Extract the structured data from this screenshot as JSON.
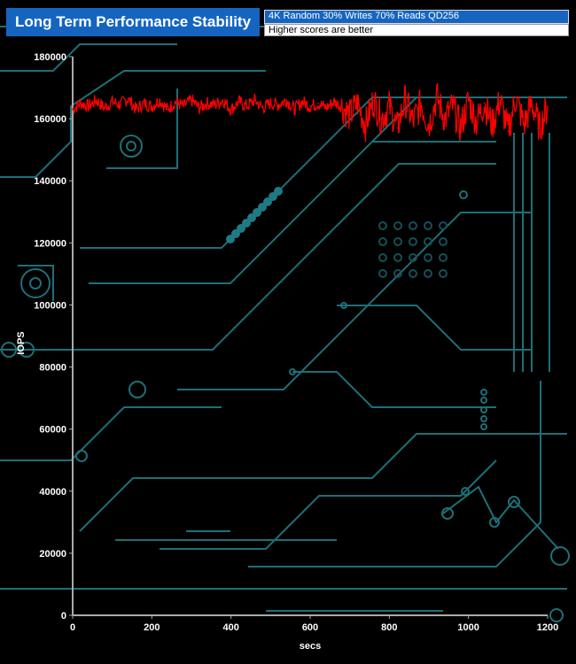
{
  "header": {
    "title": "Long Term Performance Stability",
    "subtitle": "4K Random 30% Writes 70% Reads QD256",
    "note": "Higher scores are better"
  },
  "chart_data": {
    "type": "line",
    "xlabel": "secs",
    "ylabel": "IOPS",
    "xlim": [
      0,
      1200
    ],
    "ylim": [
      0,
      180000
    ],
    "x_ticks": [
      0,
      200,
      400,
      600,
      800,
      1000,
      1200
    ],
    "y_ticks": [
      0,
      20000,
      40000,
      60000,
      80000,
      100000,
      120000,
      140000,
      160000,
      180000
    ],
    "x_tick_labels": [
      "0",
      "200",
      "400",
      "600",
      "800",
      "1000",
      "1200"
    ],
    "y_tick_labels": [
      "0",
      "20000",
      "40000",
      "60000",
      "80000",
      "100000",
      "120000",
      "140000",
      "160000",
      "180000"
    ],
    "grid": false,
    "line_color": "#ff0000",
    "series": [
      {
        "x": [
          0,
          20,
          40,
          60,
          80,
          100,
          120,
          140,
          160,
          180,
          200,
          220,
          240,
          260,
          280,
          300,
          320,
          340,
          360,
          380,
          400,
          420,
          440,
          460,
          480,
          500,
          520,
          540,
          560,
          580,
          600,
          620,
          640,
          660,
          680,
          700,
          720,
          740,
          760,
          780,
          800,
          820,
          840,
          860,
          880,
          900,
          920,
          940,
          960,
          980,
          1000,
          1020,
          1040,
          1060,
          1080,
          1100,
          1120,
          1140,
          1160,
          1180,
          1200
        ],
        "values": [
          163000,
          165000,
          164000,
          166000,
          163500,
          165500,
          164500,
          166500,
          163000,
          165000,
          164000,
          166000,
          163000,
          165500,
          164000,
          166000,
          163500,
          165000,
          164500,
          166000,
          163000,
          165500,
          164000,
          166000,
          163500,
          165000,
          164500,
          166000,
          163000,
          165500,
          164000,
          165000,
          163500,
          165500,
          164000,
          161000,
          165000,
          158000,
          166000,
          160000,
          164000,
          157000,
          166000,
          159000,
          165000,
          158000,
          167000,
          160000,
          164000,
          157000,
          166000,
          159000,
          165000,
          158000,
          166000,
          156000,
          167000,
          158000,
          165000,
          157000,
          164000
        ]
      }
    ]
  }
}
